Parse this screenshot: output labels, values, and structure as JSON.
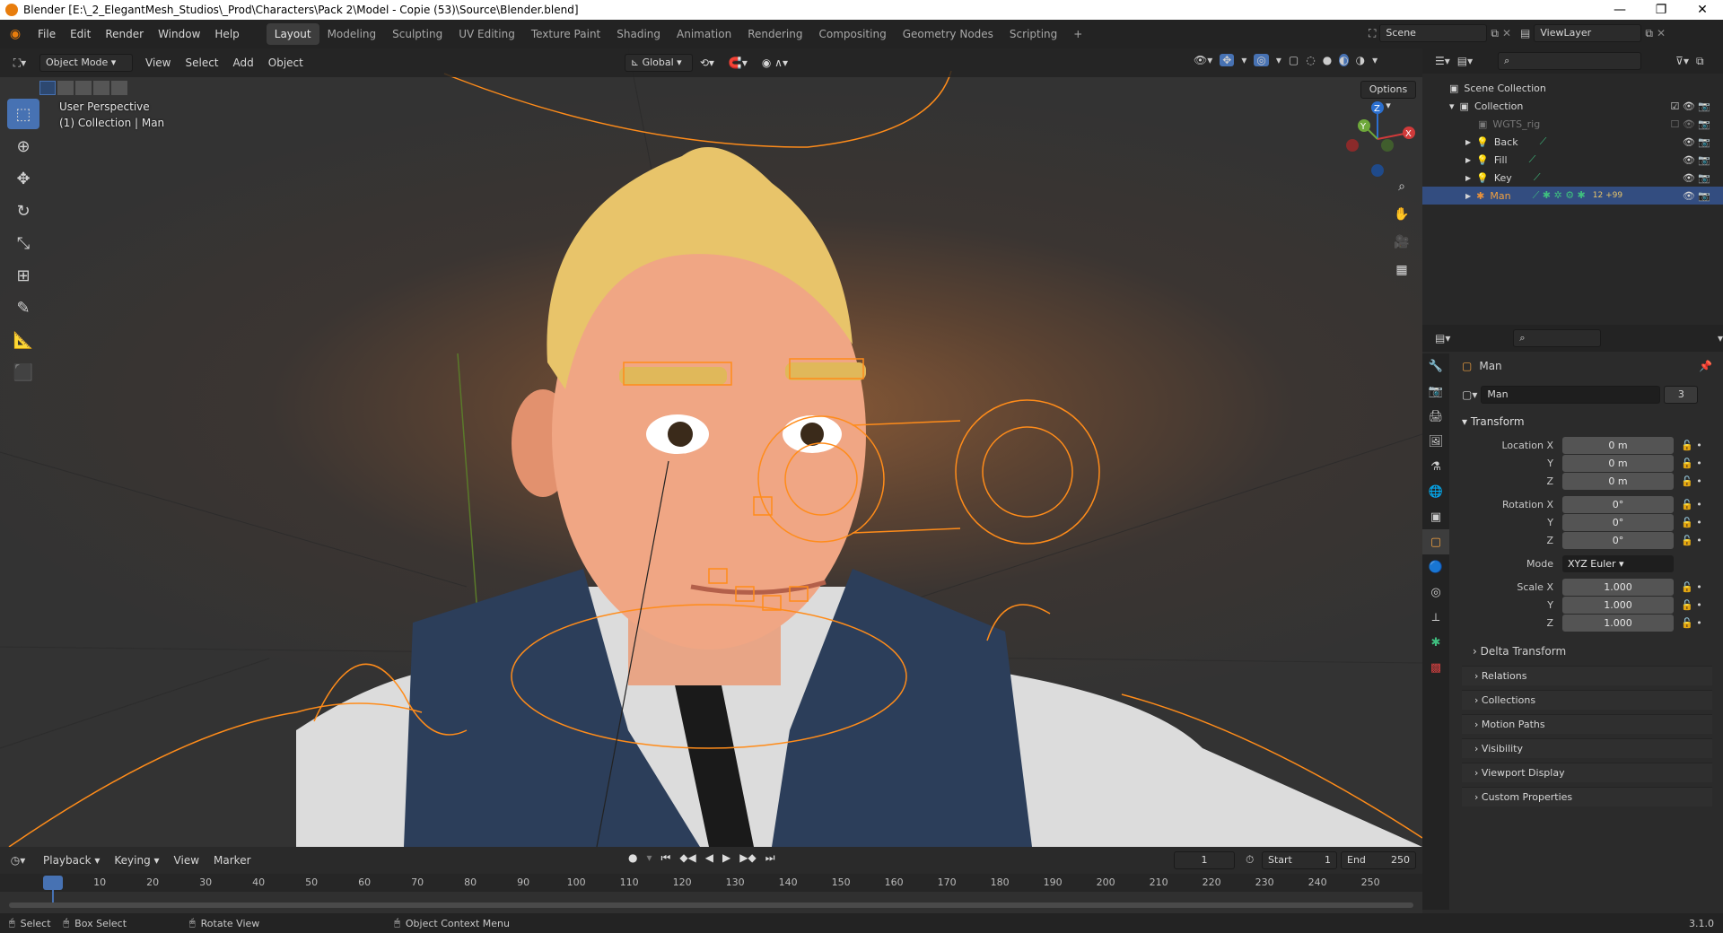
{
  "window": {
    "title": "Blender [E:\\_2_ElegantMesh_Studios\\_Prod\\Characters\\Pack 2\\Model - Copie (53)\\Source\\Blender.blend]",
    "minimize": "—",
    "maximize": "❐",
    "close": "✕"
  },
  "menus": [
    "File",
    "Edit",
    "Render",
    "Window",
    "Help"
  ],
  "workspaces": [
    "Layout",
    "Modeling",
    "Sculpting",
    "UV Editing",
    "Texture Paint",
    "Shading",
    "Animation",
    "Rendering",
    "Compositing",
    "Geometry Nodes",
    "Scripting"
  ],
  "add_workspace": "+",
  "scene": {
    "name": "Scene",
    "view_layer": "ViewLayer"
  },
  "viewport": {
    "mode": "Object Mode",
    "menus": [
      "View",
      "Select",
      "Add",
      "Object"
    ],
    "orientation": "Global",
    "options": "Options",
    "info_line1": "User Perspective",
    "info_line2": "(1) Collection | Man"
  },
  "gizmo": {
    "x": "X",
    "y": "Y",
    "z": "Z"
  },
  "outliner": {
    "root": "Scene Collection",
    "collection": "Collection",
    "items": [
      {
        "name": "WGTS_rig",
        "dim": true
      },
      {
        "name": "Back",
        "dim": false
      },
      {
        "name": "Fill",
        "dim": false
      },
      {
        "name": "Key",
        "dim": false
      },
      {
        "name": "Man",
        "dim": false,
        "selected": true
      }
    ],
    "man_badge": "12 +99"
  },
  "properties": {
    "object_name": "Man",
    "data_name": "Man",
    "users": "3",
    "transform_label": "Transform",
    "location_label": "Location X",
    "rotation_label": "Rotation X",
    "scale_label": "Scale X",
    "y": "Y",
    "z": "Z",
    "location": [
      "0 m",
      "0 m",
      "0 m"
    ],
    "rotation": [
      "0°",
      "0°",
      "0°"
    ],
    "mode_label": "Mode",
    "mode": "XYZ Euler",
    "scale": [
      "1.000",
      "1.000",
      "1.000"
    ],
    "delta": "Delta Transform",
    "panels": [
      "Relations",
      "Collections",
      "Motion Paths",
      "Visibility",
      "Viewport Display",
      "Custom Properties"
    ]
  },
  "timeline": {
    "menus": [
      "Playback",
      "Keying",
      "View",
      "Marker"
    ],
    "current_frame": "1",
    "start_label": "Start",
    "start": "1",
    "end_label": "End",
    "end": "250",
    "ticks": [
      "1",
      "10",
      "20",
      "30",
      "40",
      "50",
      "60",
      "70",
      "80",
      "90",
      "100",
      "110",
      "120",
      "130",
      "140",
      "150",
      "160",
      "170",
      "180",
      "190",
      "200",
      "210",
      "220",
      "230",
      "240",
      "250"
    ]
  },
  "status": {
    "select": "Select",
    "box_select": "Box Select",
    "rotate": "Rotate View",
    "context": "Object Context Menu",
    "version": "3.1.0"
  }
}
